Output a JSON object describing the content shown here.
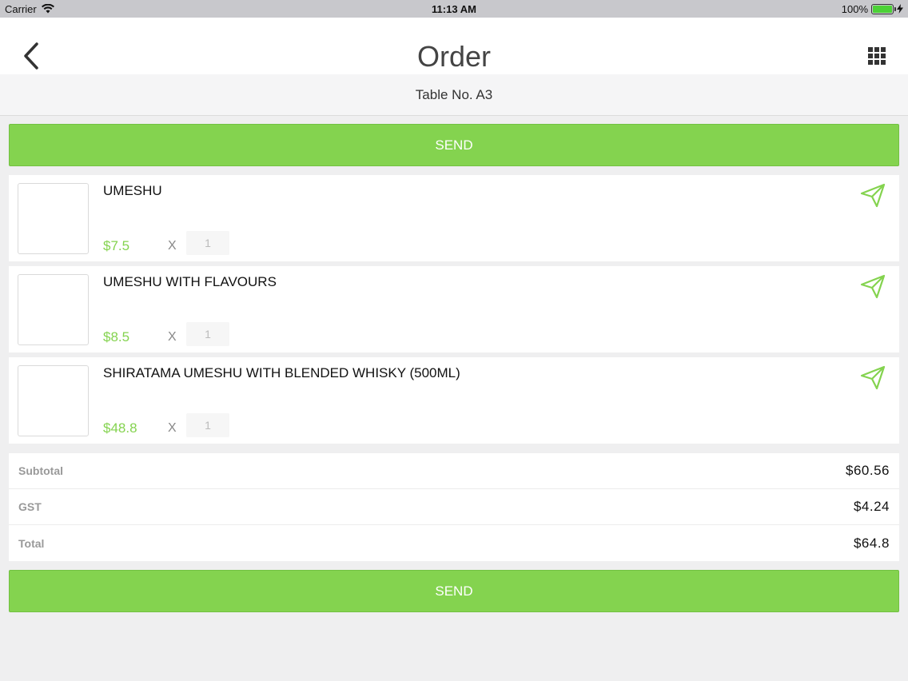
{
  "status_bar": {
    "carrier": "Carrier",
    "time": "11:13 AM",
    "battery": "100%"
  },
  "header": {
    "title": "Order",
    "back_icon": "chevron-left-icon",
    "menu_icon": "grid-icon"
  },
  "table": {
    "label": "Table No. A3"
  },
  "send_label": "SEND",
  "items": [
    {
      "name": "UMESHU",
      "price": "$7.5",
      "multiplier": "X",
      "quantity": "1"
    },
    {
      "name": "UMESHU WITH FLAVOURS",
      "price": "$8.5",
      "multiplier": "X",
      "quantity": "1"
    },
    {
      "name": "SHIRATAMA UMESHU WITH BLENDED WHISKY (500ML)",
      "price": "$48.8",
      "multiplier": "X",
      "quantity": "1"
    }
  ],
  "totals": {
    "subtotal_label": "Subtotal",
    "subtotal_value": "$60.56",
    "gst_label": "GST",
    "gst_value": "$4.24",
    "total_label": "Total",
    "total_value": "$64.8"
  },
  "colors": {
    "accent": "#84d34f",
    "background": "#efeff0"
  }
}
